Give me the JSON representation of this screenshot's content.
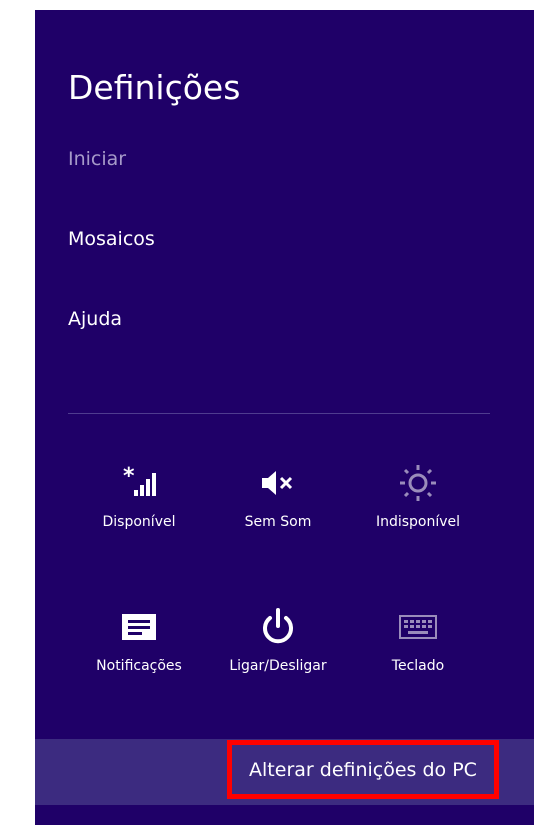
{
  "panel": {
    "title": "Definições",
    "background": "#1f0068",
    "footer_background": "#3c2b80",
    "highlight_color": "#ff0000"
  },
  "menu": {
    "items": [
      {
        "label": "Iniciar",
        "state": "dimmed"
      },
      {
        "label": "Mosaicos",
        "state": "normal"
      },
      {
        "label": "Ajuda",
        "state": "normal"
      }
    ]
  },
  "quick_settings": {
    "tiles": [
      {
        "label": "Disponível",
        "icon": "network-icon"
      },
      {
        "label": "Sem Som",
        "icon": "volume-muted-icon"
      },
      {
        "label": "Indisponível",
        "icon": "brightness-icon"
      },
      {
        "label": "Notificações",
        "icon": "notifications-icon"
      },
      {
        "label": "Ligar/Desligar",
        "icon": "power-icon"
      },
      {
        "label": "Teclado",
        "icon": "keyboard-icon"
      }
    ]
  },
  "footer": {
    "link_label": "Alterar definições do PC"
  }
}
